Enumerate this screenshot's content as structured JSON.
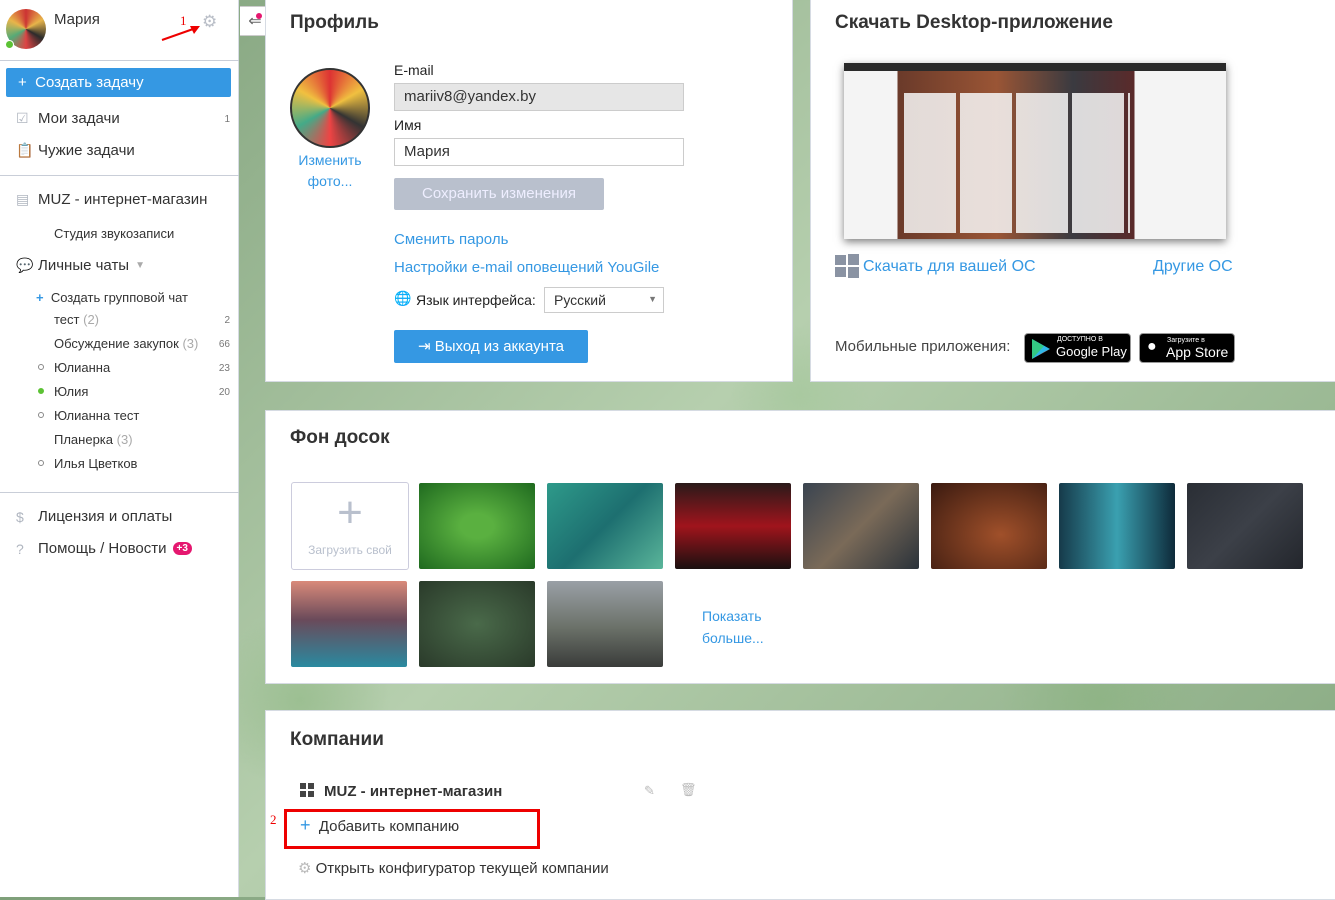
{
  "sidebar": {
    "user_name": "Мария",
    "annotation_1": "1",
    "create_task": "Создать задачу",
    "my_tasks": "Мои задачи",
    "my_tasks_count": "1",
    "others_tasks": "Чужие задачи",
    "project": "MUZ - интернет-магазин",
    "board": "Студия звукозаписи",
    "chats_label": "Личные чаты",
    "create_group_chat": "Создать групповой чат",
    "chats": [
      {
        "name": "тест",
        "members": "(2)",
        "count": "2"
      },
      {
        "name": "Обсуждение закупок",
        "members": "(3)",
        "count": "66"
      },
      {
        "name": "Юлианна",
        "members": "",
        "count": "23"
      },
      {
        "name": "Юлия",
        "members": "",
        "count": "20"
      },
      {
        "name": "Юлианна тест",
        "members": "",
        "count": ""
      },
      {
        "name": "Планерка",
        "members": "(3)",
        "count": ""
      },
      {
        "name": "Илья Цветков",
        "members": "",
        "count": ""
      }
    ],
    "license": "Лицензия и оплаты",
    "help": "Помощь / Новости",
    "help_badge": "+3"
  },
  "profile": {
    "title": "Профиль",
    "change_photo_1": "Изменить",
    "change_photo_2": "фото...",
    "email_label": "E-mail",
    "email_value": "mariiv8@yandex.by",
    "name_label": "Имя",
    "name_value": "Мария",
    "save": "Сохранить изменения",
    "change_password": "Сменить пароль",
    "email_settings": "Настройки e-mail оповещений YouGile",
    "language_label": "Язык интерфейса:",
    "language_value": "Русский",
    "logout": "Выход из аккаунта"
  },
  "download": {
    "title": "Скачать Desktop-приложение",
    "download_os": "Скачать для вашей ОС",
    "other_os": "Другие ОС",
    "mobile_label": "Мобильные приложения:",
    "gplay_small": "ДОСТУПНО В",
    "gplay_big": "Google Play",
    "appstore_small": "Загрузите в",
    "appstore_big": "App Store"
  },
  "backgrounds": {
    "title": "Фон досок",
    "upload": "Загрузить свой",
    "show_more_1": "Показать",
    "show_more_2": "больше..."
  },
  "companies": {
    "title": "Компании",
    "company": "MUZ - интернет-магазин",
    "add": "Добавить компанию",
    "annotation_2": "2",
    "configurator": "Открыть конфигуратор текущей компании"
  },
  "colors": {
    "accent": "#3598e3",
    "annotation": "#e00000",
    "online": "#5cc234",
    "badge": "#e5176f"
  }
}
